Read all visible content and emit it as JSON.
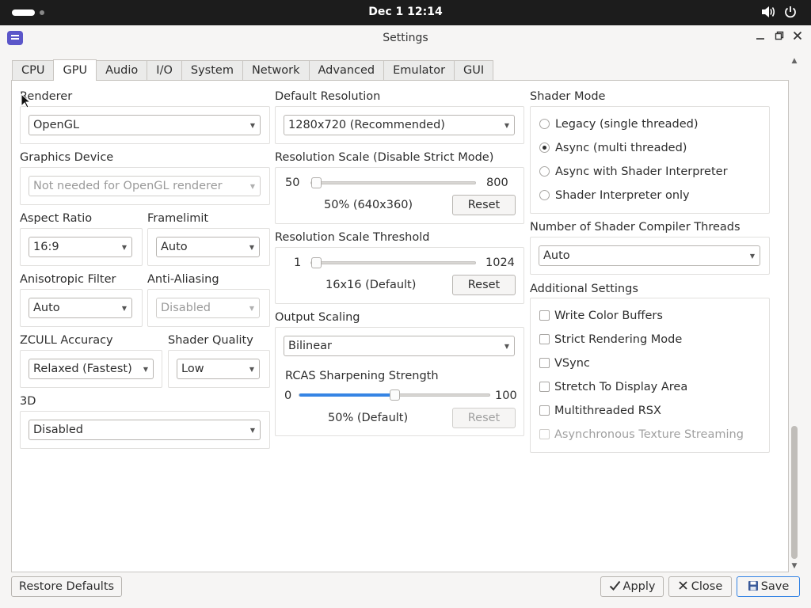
{
  "topbar": {
    "clock": "Dec 1  12:14",
    "icons": [
      "volume-icon",
      "power-icon"
    ]
  },
  "window": {
    "title": "Settings",
    "controls": [
      "minimize",
      "maximize",
      "close"
    ]
  },
  "tabs": [
    {
      "label": "CPU",
      "active": false
    },
    {
      "label": "GPU",
      "active": true
    },
    {
      "label": "Audio",
      "active": false
    },
    {
      "label": "I/O",
      "active": false
    },
    {
      "label": "System",
      "active": false
    },
    {
      "label": "Network",
      "active": false
    },
    {
      "label": "Advanced",
      "active": false
    },
    {
      "label": "Emulator",
      "active": false
    },
    {
      "label": "GUI",
      "active": false
    }
  ],
  "left": {
    "renderer": {
      "label": "Renderer",
      "value": "OpenGL"
    },
    "graphics_device": {
      "label": "Graphics Device",
      "value": "Not needed for OpenGL renderer",
      "disabled": true
    },
    "aspect_ratio": {
      "label": "Aspect Ratio",
      "value": "16:9"
    },
    "framelimit": {
      "label": "Framelimit",
      "value": "Auto"
    },
    "anisotropic": {
      "label": "Anisotropic Filter",
      "value": "Auto"
    },
    "anti_aliasing": {
      "label": "Anti-Aliasing",
      "value": "Disabled",
      "disabled": true
    },
    "zcull": {
      "label": "ZCULL Accuracy",
      "value": "Relaxed (Fastest)"
    },
    "shader_quality": {
      "label": "Shader Quality",
      "value": "Low"
    },
    "three_d": {
      "label": "3D",
      "value": "Disabled"
    }
  },
  "middle": {
    "default_resolution": {
      "label": "Default Resolution",
      "value": "1280x720 (Recommended)"
    },
    "resolution_scale": {
      "label": "Resolution Scale (Disable Strict Mode)",
      "min": "50",
      "max": "800",
      "value": 50,
      "value_text": "50% (640x360)",
      "reset": "Reset"
    },
    "threshold": {
      "label": "Resolution Scale Threshold",
      "min": "1",
      "max": "1024",
      "value": 1,
      "value_text": "16x16 (Default)",
      "reset": "Reset"
    },
    "output_scaling": {
      "label": "Output Scaling",
      "value": "Bilinear"
    },
    "rcas": {
      "label": "RCAS Sharpening Strength",
      "min": "0",
      "max": "100",
      "value": 50,
      "value_text": "50% (Default)",
      "reset": "Reset",
      "reset_disabled": true
    }
  },
  "right": {
    "shader_mode": {
      "label": "Shader Mode",
      "options": [
        {
          "label": "Legacy (single threaded)",
          "checked": false
        },
        {
          "label": "Async (multi threaded)",
          "checked": true
        },
        {
          "label": "Async with Shader Interpreter",
          "checked": false
        },
        {
          "label": "Shader Interpreter only",
          "checked": false
        }
      ]
    },
    "compiler_threads": {
      "label": "Number of Shader Compiler Threads",
      "value": "Auto"
    },
    "additional": {
      "label": "Additional Settings",
      "options": [
        {
          "label": "Write Color Buffers",
          "checked": false,
          "disabled": false
        },
        {
          "label": "Strict Rendering Mode",
          "checked": false,
          "disabled": false
        },
        {
          "label": "VSync",
          "checked": false,
          "disabled": false
        },
        {
          "label": "Stretch To Display Area",
          "checked": false,
          "disabled": false
        },
        {
          "label": "Multithreaded RSX",
          "checked": false,
          "disabled": false
        },
        {
          "label": "Asynchronous Texture Streaming",
          "checked": false,
          "disabled": true
        }
      ]
    }
  },
  "footer": {
    "restore_defaults": "Restore Defaults",
    "apply": "Apply",
    "close": "Close",
    "save": "Save"
  },
  "colors": {
    "accent": "#3584e4",
    "topbar": "#1c1c1c",
    "app_icon": "#5b56c9"
  }
}
